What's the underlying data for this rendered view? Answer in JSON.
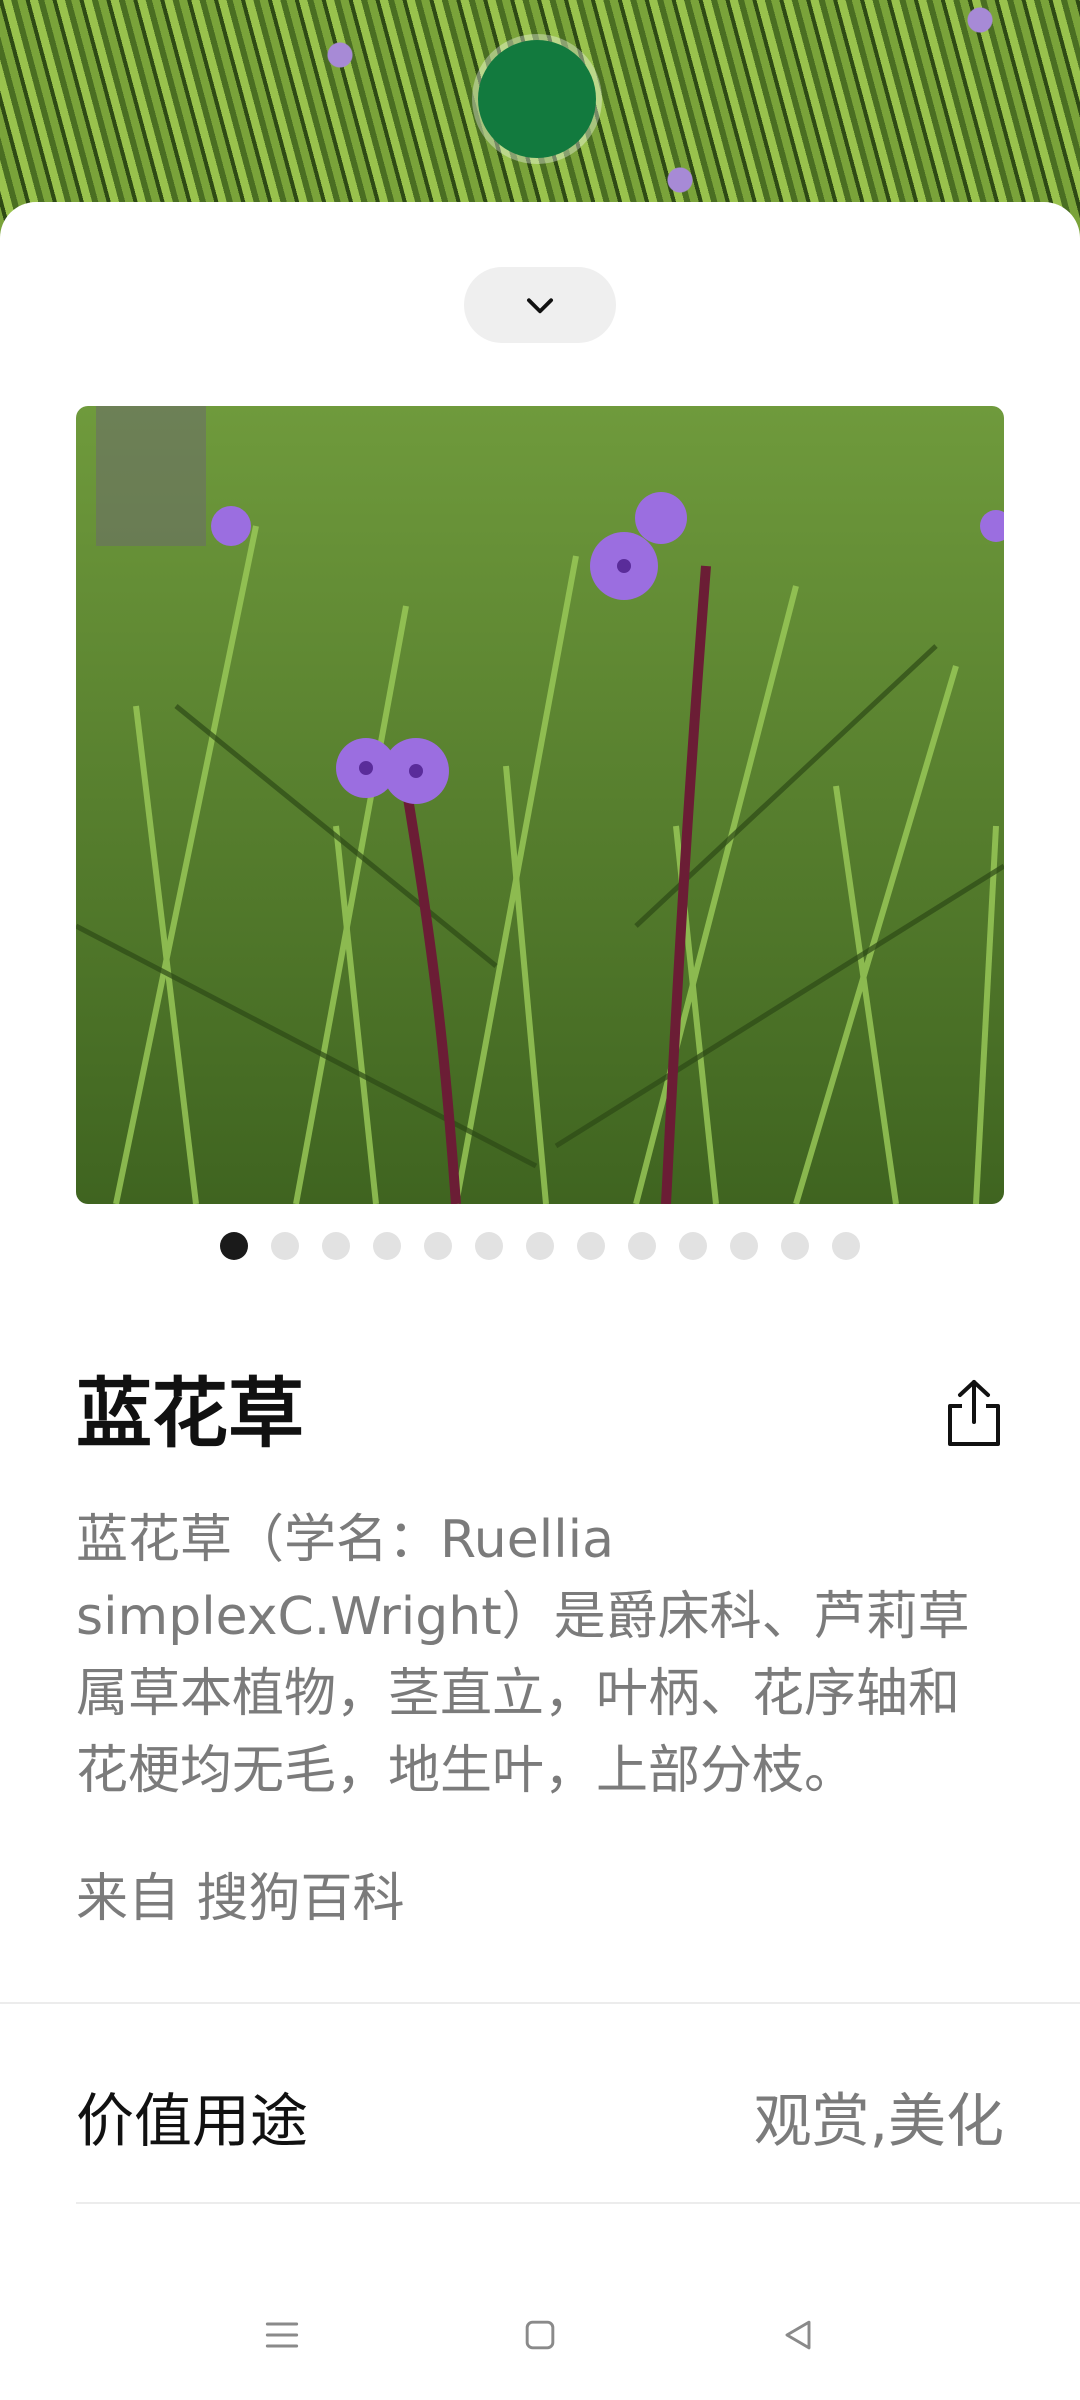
{
  "plant": {
    "name": "蓝花草",
    "description": "蓝花草（学名：Ruellia simplexC.Wright）是爵床科、芦莉草属草本植物，茎直立，叶柄、花序轴和花梗均无毛，地生叶，上部分枝。",
    "source": "来自 搜狗百科"
  },
  "carousel": {
    "total": 13,
    "active_index": 0
  },
  "attributes": [
    {
      "label": "价值用途",
      "value": "观赏,美化"
    }
  ],
  "icons": {
    "collapse": "chevron-down-icon",
    "share": "share-icon",
    "nav_menu": "menu-icon",
    "nav_home": "home-icon",
    "nav_back": "back-icon"
  },
  "colors": {
    "camera_dot": "#127a3e",
    "flower": "#9b6ee0",
    "text_secondary": "#7b7b7b"
  }
}
